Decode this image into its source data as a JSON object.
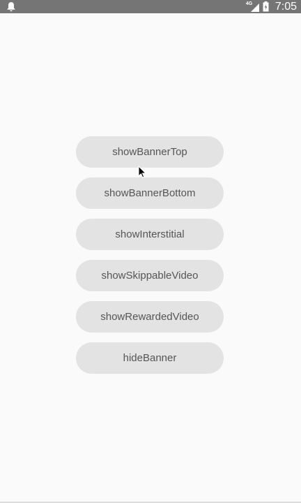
{
  "status_bar": {
    "network_type": "4G",
    "time": "7:05",
    "icons": [
      "notification-bell-icon",
      "signal-icon",
      "battery-icon"
    ]
  },
  "buttons": [
    {
      "label": "showBannerTop"
    },
    {
      "label": "showBannerBottom"
    },
    {
      "label": "showInterstitial"
    },
    {
      "label": "showSkippableVideo"
    },
    {
      "label": "showRewardedVideo"
    },
    {
      "label": "hideBanner"
    }
  ],
  "colors": {
    "status_bar": "#757575",
    "background": "#fafafa",
    "button": "#e3e3e3",
    "button_text": "#555555"
  }
}
